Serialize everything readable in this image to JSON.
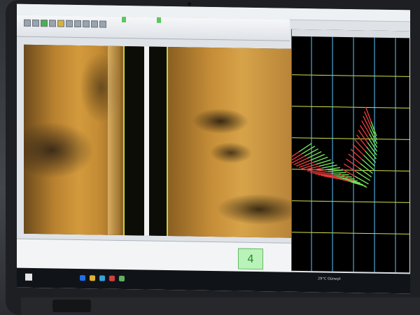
{
  "window": {
    "title": ""
  },
  "badges": [],
  "navigation": {
    "panel_title": "",
    "lat_labels": [],
    "lon_labels": [],
    "grid_color": "#d8e04a",
    "vertical_grid_color": "#58c8ff",
    "port_beam_color": "#e23b3b",
    "starboard_beam_color": "#74e05a"
  },
  "status": {
    "cells": [],
    "channel_number": "4"
  },
  "taskbar": {
    "weather": "29°C Güneşli",
    "time": "",
    "date": ""
  },
  "sonar": {
    "bottom_line_color": "#c9d23a",
    "seabed_color": "#c48c34"
  }
}
